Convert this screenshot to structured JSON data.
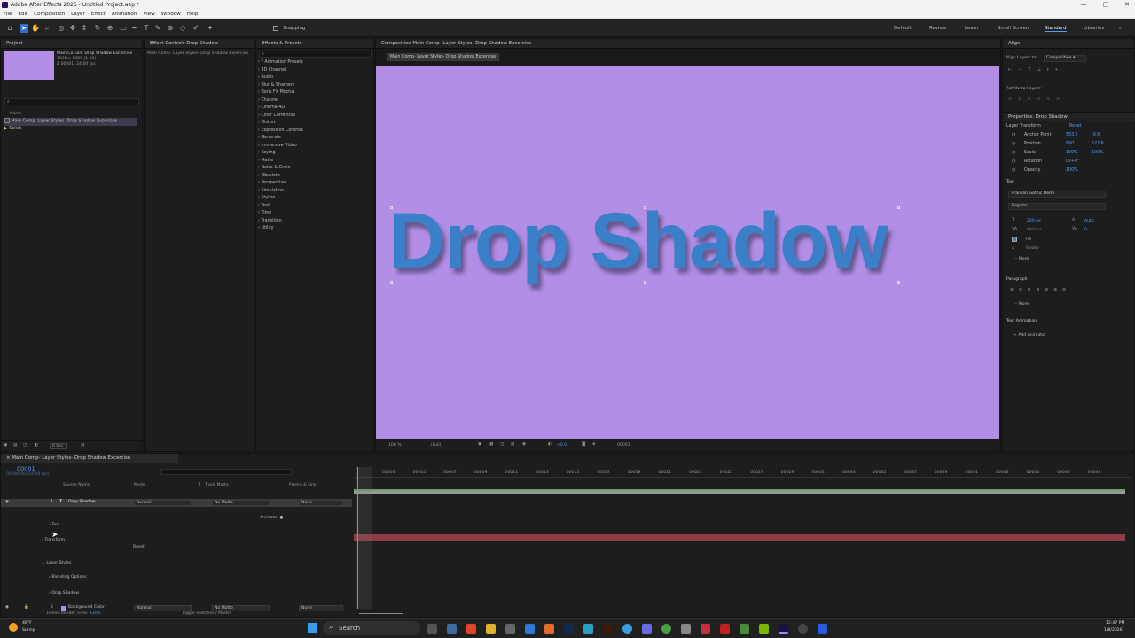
{
  "app": {
    "title": "Adobe After Effects 2025 - Untitled Project.aep *"
  },
  "menu": [
    "File",
    "Edit",
    "Composition",
    "Layer",
    "Effect",
    "Animation",
    "View",
    "Window",
    "Help"
  ],
  "toolbar": {
    "snapping": "Snapping",
    "workspaces": [
      "Default",
      "Review",
      "Learn",
      "Small Screen",
      "Standard",
      "Libraries"
    ],
    "active_workspace": "Standard"
  },
  "project": {
    "title": "Project",
    "comp_name": "Main Co..ion- Drop Shadow Excercise",
    "comp_info": "1920 x 1080 (1.00)",
    "comp_fps": "Δ 00001, 24.00 fps",
    "search_placeholder": "⌕",
    "name_header": "Name",
    "items": [
      "Main Comp- Layer Styles- Drop Shadow Excercise",
      "Solids"
    ],
    "bpc": "8 bpc"
  },
  "effect_controls": {
    "title": "Effect Controls Drop Shadow",
    "layer": "Main Comp- Layer Styles- Drop Shadow Excercise"
  },
  "effects_presets": {
    "title": "Effects & Presets",
    "search_placeholder": "⌕",
    "items": [
      "* Animation Presets",
      "3D Channel",
      "Audio",
      "Blur & Sharpen",
      "Boris FX Mocha",
      "Channel",
      "Cinema 4D",
      "Color Correction",
      "Distort",
      "Expression Controls",
      "Generate",
      "Immersive Video",
      "Keying",
      "Matte",
      "Noise & Grain",
      "Obsolete",
      "Perspective",
      "Simulation",
      "Stylize",
      "Text",
      "Time",
      "Transition",
      "Utility"
    ]
  },
  "composition": {
    "title": "Composition Main Comp- Layer Styles- Drop Shadow Excercise",
    "tab": "Main Comp- Layer Styles- Drop Shadow Excercise",
    "text": "Drop Shadow",
    "zoom": "100 %",
    "quality": "(Full)",
    "offset": "+0.0",
    "timecode": "00001"
  },
  "align": {
    "title": "Align",
    "align_to_label": "Align Layers to:",
    "align_to_value": "Composition",
    "distribute_label": "Distribute Layers:"
  },
  "properties": {
    "title": "Properties: Drop Shadow",
    "layer_transform": "Layer Transform",
    "reset": "Reset",
    "rows": [
      {
        "label": "Anchor Point",
        "v1": "583.2",
        "v2": "-0.6"
      },
      {
        "label": "Position",
        "v1": "960",
        "v2": "522.6"
      },
      {
        "label": "Scale",
        "v1": "100%",
        "v2": "100%"
      },
      {
        "label": "Rotation",
        "v1": "0x+0°",
        "v2": ""
      },
      {
        "label": "Opacity",
        "v1": "100%",
        "v2": ""
      }
    ],
    "text_section": "Text",
    "font": "Franklin Gothic Demi",
    "style": "Regular",
    "size": "200 px",
    "leading": "Auto",
    "kerning": "Metrics",
    "tracking": "0",
    "fill": "Fill",
    "stroke": "Stroke",
    "more": "More",
    "paragraph": "Paragraph",
    "more2": "More",
    "text_animation": "Text Animation",
    "add_animator": "Add Animator"
  },
  "timeline": {
    "tab": "Main Comp- Layer Styles- Drop Shadow Excercise",
    "timecode": "00001",
    "timecode_sub": "00000:00 (24.00 fps)",
    "headers": {
      "source_name": "Source Name",
      "mode": "Mode",
      "t": "T",
      "track_matte": "Track Matte",
      "parent": "Parent & Link"
    },
    "layers": [
      {
        "num": "1",
        "name": "Drop Shadow",
        "mode": "Normal",
        "matte": "No Matte",
        "parent": "None"
      },
      {
        "num": "2",
        "name": "Background Color",
        "mode": "Normal",
        "matte": "No Matte",
        "parent": "None"
      }
    ],
    "sub": [
      "Text",
      "Transform",
      "Layer Styles",
      "Blending Options",
      "Drop Shadow"
    ],
    "animate": "Animate:",
    "reset": "Reset",
    "ruler": [
      "00003",
      "00005",
      "00007",
      "00009",
      "00011",
      "00013",
      "00015",
      "00017",
      "00019",
      "00021",
      "00023",
      "00025",
      "00027",
      "00029",
      "00031",
      "00033",
      "00035",
      "00037",
      "00039",
      "00041",
      "00043",
      "00045",
      "00047",
      "00049"
    ],
    "frame_render": "Frame Render Time:",
    "frame_render_val": "13ms",
    "toggle": "Toggle Switches / Modes"
  },
  "taskbar": {
    "weather_temp": "48°F",
    "weather_desc": "Sunny",
    "search": "Search",
    "time": "12:47 PM",
    "date": "1/8/2026"
  },
  "colors": {
    "accent": "#4a9eff",
    "comp_bg": "#b28ee6",
    "text": "#3a80c8",
    "layer_bar": "#8e3b45"
  }
}
